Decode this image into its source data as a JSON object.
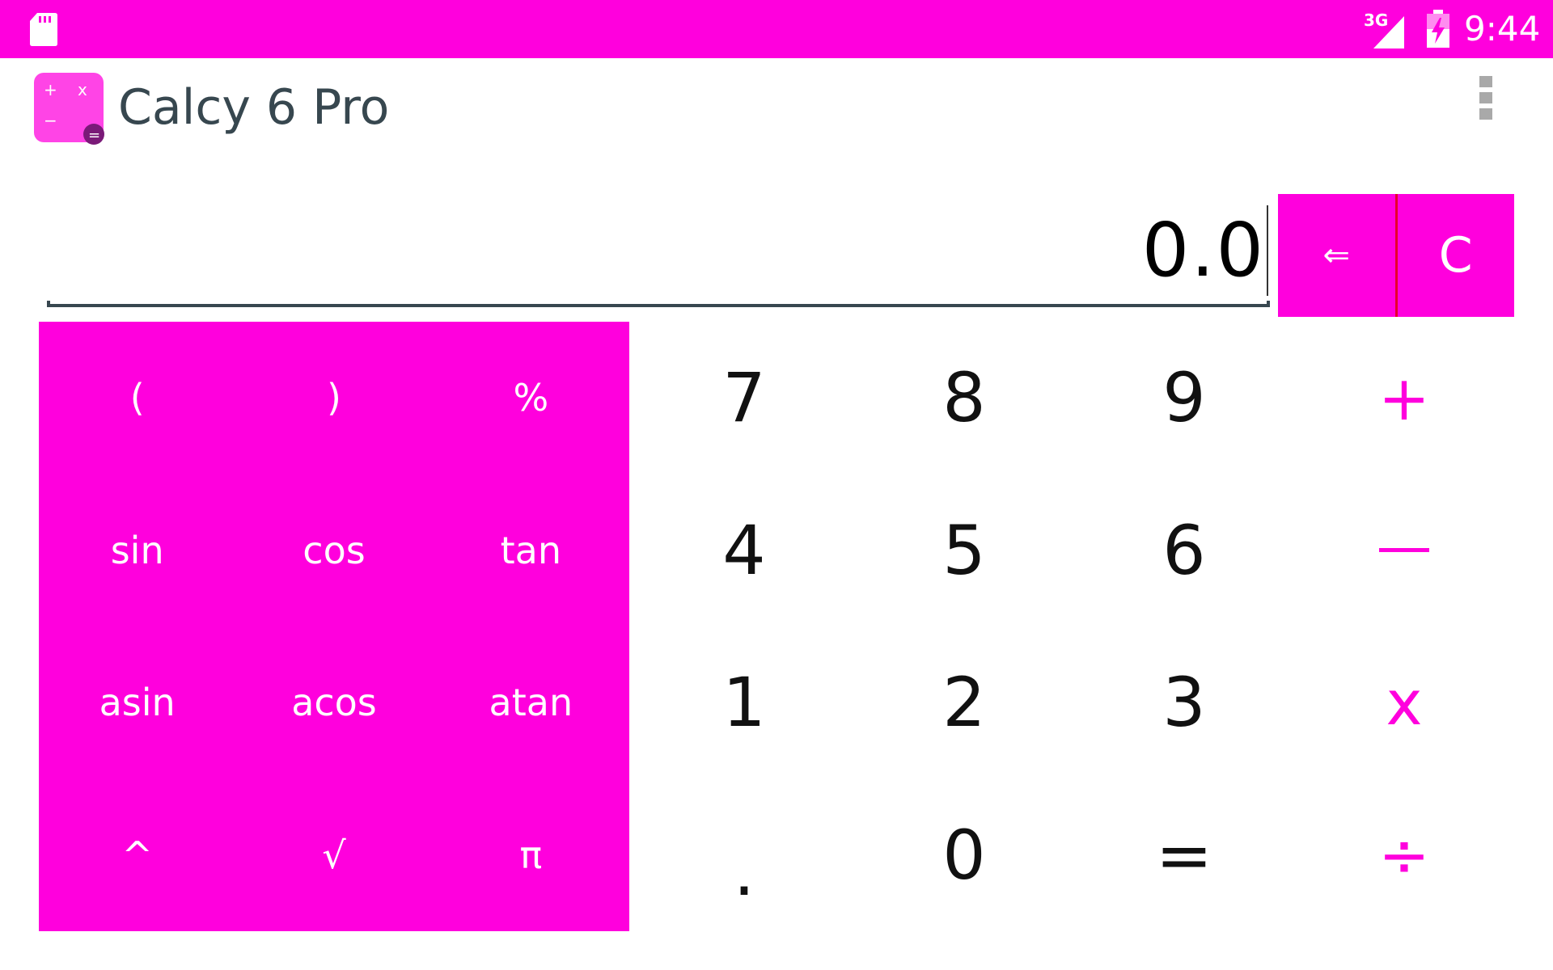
{
  "status_bar": {
    "network": "3G",
    "time": "9:44",
    "icons": [
      "sd-card-icon",
      "signal-icon",
      "battery-charging-icon"
    ]
  },
  "app_bar": {
    "title": "Calcy 6 Pro",
    "logo_symbols": {
      "plus": "+",
      "times": "x",
      "minus": "−",
      "equals": "="
    },
    "menu_icon": "overflow-menu-icon"
  },
  "display": {
    "value": "0.0"
  },
  "controls": {
    "backspace": "⇐",
    "clear": "C"
  },
  "scientific_keys": [
    {
      "label": "(",
      "name": "open-paren"
    },
    {
      "label": ")",
      "name": "close-paren"
    },
    {
      "label": "%",
      "name": "percent"
    },
    {
      "label": "sin",
      "name": "sin"
    },
    {
      "label": "cos",
      "name": "cos"
    },
    {
      "label": "tan",
      "name": "tan"
    },
    {
      "label": "asin",
      "name": "asin"
    },
    {
      "label": "acos",
      "name": "acos"
    },
    {
      "label": "atan",
      "name": "atan"
    },
    {
      "label": "^",
      "name": "power"
    },
    {
      "label": "√",
      "name": "sqrt"
    },
    {
      "label": "π",
      "name": "pi"
    }
  ],
  "number_keys": {
    "row1": [
      "7",
      "8",
      "9"
    ],
    "row2": [
      "4",
      "5",
      "6"
    ],
    "row3": [
      "1",
      "2",
      "3"
    ],
    "row4": [
      ".",
      "0",
      "="
    ]
  },
  "operator_keys": {
    "plus": "+",
    "minus": "—",
    "multiply": "x",
    "divide": "÷"
  },
  "colors": {
    "accent": "#ff00dd",
    "title_text": "#37474f",
    "digit_text": "#111111",
    "background": "#ffffff"
  }
}
